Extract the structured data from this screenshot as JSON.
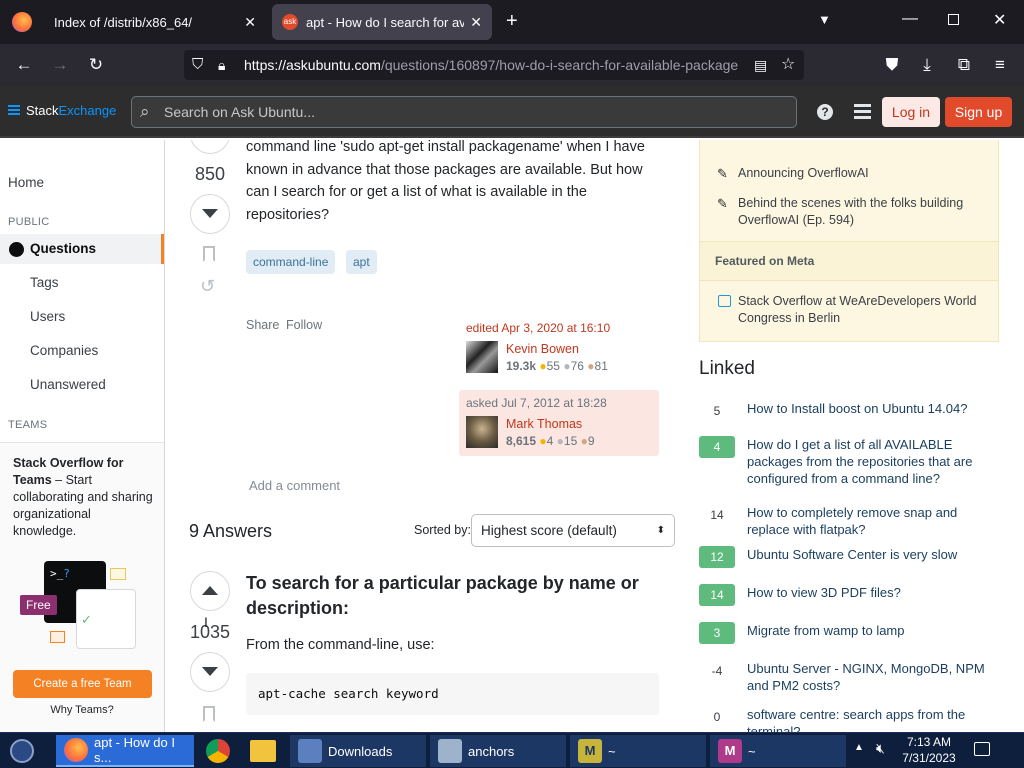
{
  "browser": {
    "tabs": [
      {
        "title": "Index of /distrib/x86_64/"
      },
      {
        "title": "apt - How do I search for availa"
      }
    ],
    "url_host": "https://askubuntu.com",
    "url_path": "/questions/160897/how-do-i-search-for-available-package"
  },
  "se_header": {
    "brand_a": "Stack",
    "brand_b": "Exchange",
    "search_placeholder": "Search on Ask Ubuntu...",
    "login": "Log in",
    "signup": "Sign up"
  },
  "leftnav": {
    "home": "Home",
    "public": "PUBLIC",
    "questions": "Questions",
    "tags": "Tags",
    "users": "Users",
    "companies": "Companies",
    "unanswered": "Unanswered",
    "teams": "TEAMS",
    "teams_promo_title": "Stack Overflow for Teams",
    "teams_promo_rest": " – Start collaborating and sharing organizational knowledge.",
    "free_badge": "Free",
    "create_team": "Create a free Team",
    "why_teams": "Why Teams?"
  },
  "question": {
    "score": "850",
    "body_text": "command line 'sudo apt-get install packagename' when I have known in advance that those packages are available. But how can I search for or get a list of what is available in the repositories?",
    "tags": [
      "command-line",
      "apt"
    ],
    "share": "Share",
    "follow": "Follow",
    "edited_label": "edited Apr 3, 2020 at 16:10",
    "editor_name": "Kevin Bowen",
    "editor_rep": "19.3k",
    "editor_gold": "55",
    "editor_silver": "76",
    "editor_bronze": "81",
    "asked_label": "asked Jul 7, 2012 at 18:28",
    "asker_name": "Mark Thomas",
    "asker_rep": "8,615",
    "asker_gold": "4",
    "asker_silver": "15",
    "asker_bronze": "9",
    "add_comment": "Add a comment"
  },
  "answers": {
    "count": "9 Answers",
    "sorted_by": "Sorted by:",
    "sort_value": "Highest score (default)",
    "first_score": "1035",
    "first_heading": "To search for a particular package by name or description:",
    "first_text": "From the command-line, use:",
    "first_code": "apt-cache search keyword"
  },
  "sidebar_right": {
    "blog_items": [
      "Announcing OverflowAI",
      "Behind the scenes with the folks building OverflowAI (Ep. 594)"
    ],
    "featured_meta_title": "Featured on Meta",
    "meta_items": [
      "Stack Overflow at WeAreDevelopers World Congress in Berlin"
    ],
    "linked_title": "Linked",
    "linked": [
      {
        "score": "5",
        "accepted": false,
        "title": "How to Install boost on Ubuntu 14.04?"
      },
      {
        "score": "4",
        "accepted": true,
        "title": "How do I get a list of all AVAILABLE packages from the repositories that are configured from a command line?"
      },
      {
        "score": "14",
        "accepted": false,
        "title": "How to completely remove snap and replace with flatpak?"
      },
      {
        "score": "12",
        "accepted": true,
        "title": "Ubuntu Software Center is very slow"
      },
      {
        "score": "14",
        "accepted": true,
        "title": "How to view 3D PDF files?"
      },
      {
        "score": "3",
        "accepted": true,
        "title": "Migrate from wamp to lamp"
      },
      {
        "score": "-4",
        "accepted": false,
        "title": "Ubuntu Server - NGINX, MongoDB, NPM and PM2 costs?"
      },
      {
        "score": "0",
        "accepted": false,
        "title": "software centre: search apps from the terminal?"
      }
    ]
  },
  "taskbar": {
    "items": [
      "apt - How do I s...",
      "Downloads",
      "anchors",
      "~",
      "~"
    ],
    "time": "7:13 AM",
    "date": "7/31/2023"
  },
  "colors": {
    "accent": "#f48225",
    "link": "#1a3e5e",
    "brand_blue": "#0a95ff",
    "signup": "#e14b2c"
  }
}
